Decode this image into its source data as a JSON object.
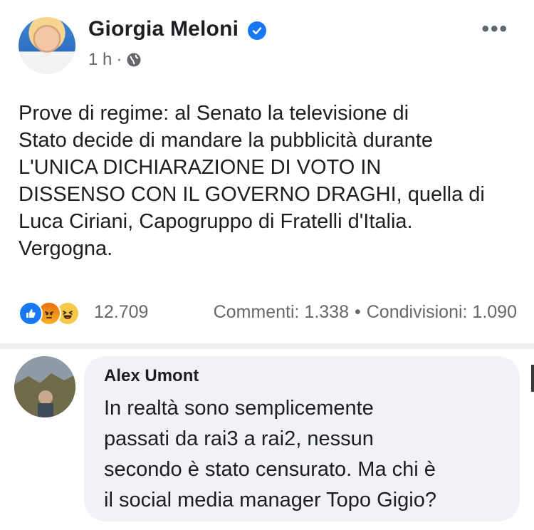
{
  "post": {
    "author": "Giorgia Meloni",
    "time": "1 h",
    "separator": "·",
    "text": "Prove di regime: al Senato la televisione di\nStato decide di mandare la pubblicità durante\nL'UNICA DICHIARAZIONE DI VOTO IN\nDISSENSO CON IL GOVERNO DRAGHI, quella di\nLuca Ciriani, Capogruppo di Fratelli d'Italia.\nVergogna.",
    "reaction_count": "12.709",
    "comments": "Commenti: 1.338",
    "stats_separator": "•",
    "shares": "Condivisioni: 1.090",
    "more": "•••"
  },
  "comment": {
    "author": "Alex Umont",
    "text": "In realtà sono semplicemente\npassati da rai3 a rai2, nessun\nsecondo è stato censurato. Ma chi è\nil social media manager Topo Gigio?"
  },
  "icons": {
    "verified": "verified-badge-icon",
    "globe": "globe-icon",
    "more": "more-options-icon",
    "like": "like-reaction-icon",
    "angry": "angry-reaction-icon",
    "haha": "haha-reaction-icon"
  },
  "colors": {
    "brand_blue": "#1877f2",
    "secondary_text": "#65676b",
    "bubble_bg": "#f0f2f5"
  }
}
